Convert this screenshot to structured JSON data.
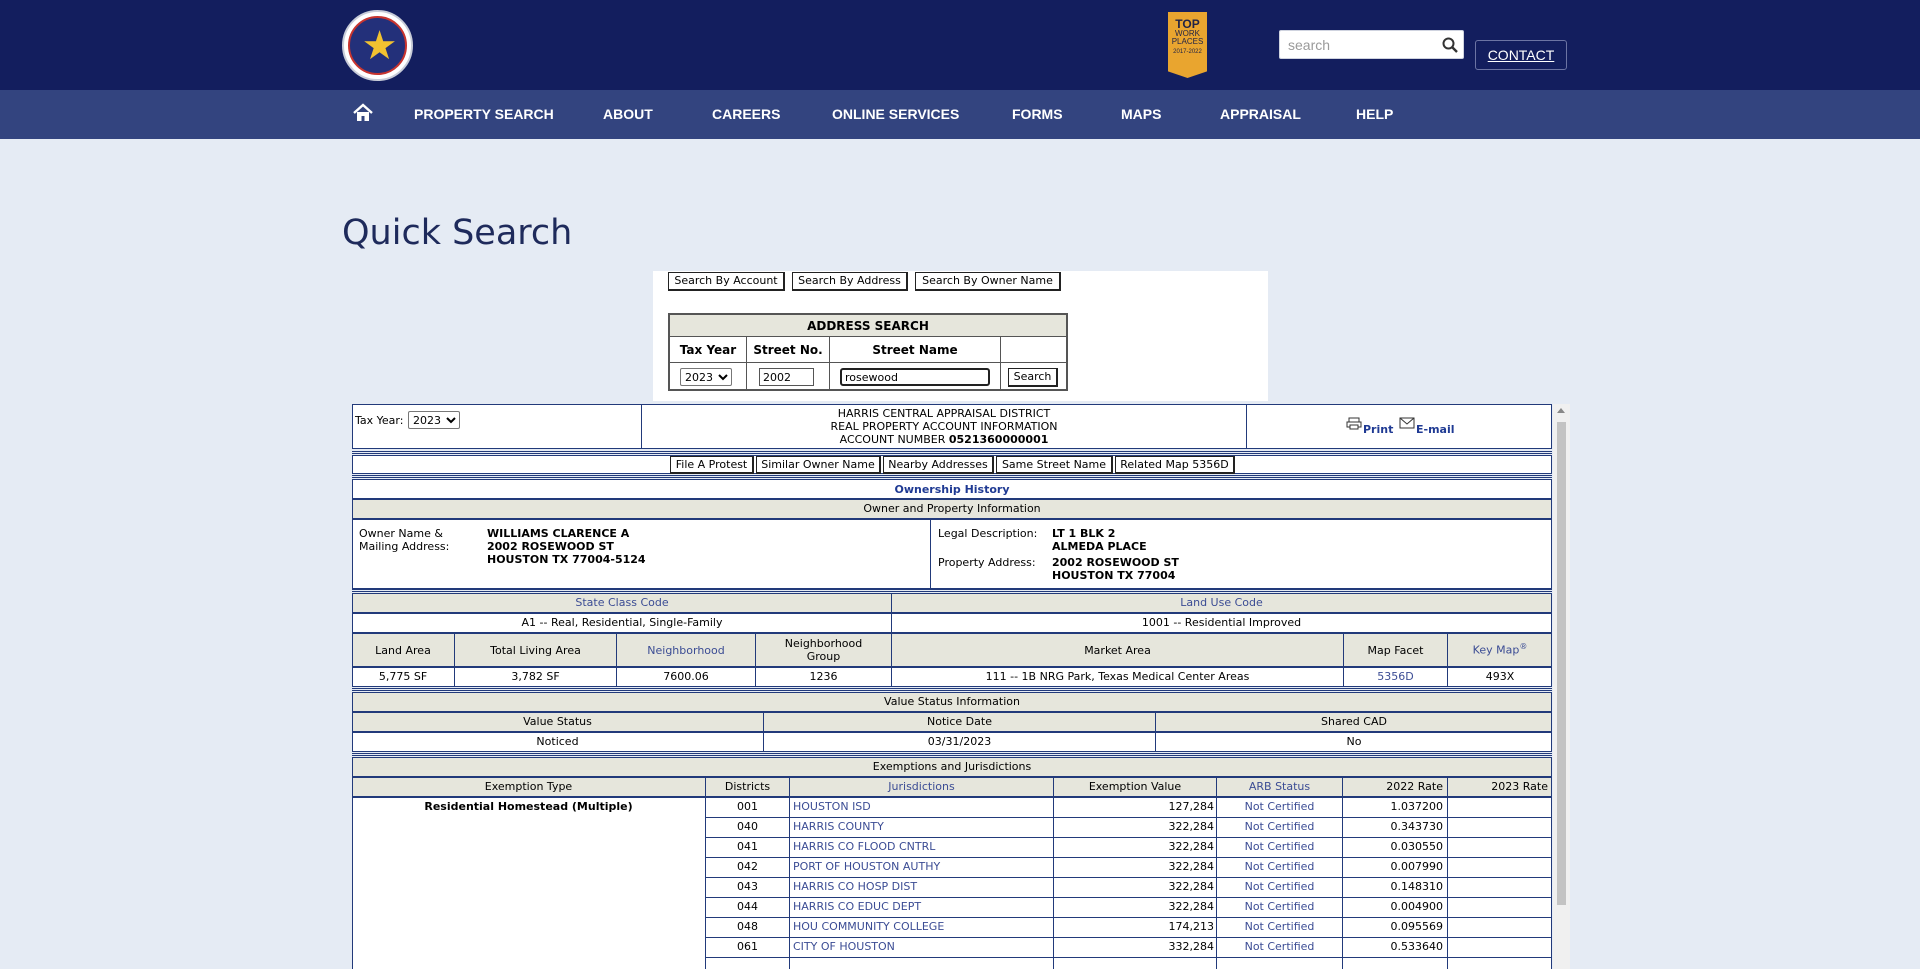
{
  "header": {
    "logo_text": "HARRIS CENTRAL APPRAISAL DISTRICT",
    "badge": {
      "line1": "TOP",
      "line2": "WORK",
      "line3": "PLACES",
      "line4": "2017-2022"
    },
    "search_placeholder": "search",
    "contact_label": "CONTACT"
  },
  "nav": {
    "items": [
      "PROPERTY SEARCH",
      "ABOUT",
      "CAREERS",
      "ONLINE SERVICES",
      "FORMS",
      "MAPS",
      "APPRAISAL",
      "HELP"
    ]
  },
  "page_title": "Quick Search",
  "search_tabs": [
    "Search By Account",
    "Search By Address",
    "Search By Owner Name"
  ],
  "address_search": {
    "title": "ADDRESS SEARCH",
    "col_tax_year": "Tax Year",
    "col_street_no": "Street No.",
    "col_street_name": "Street Name",
    "tax_year_value": "2023",
    "street_no_value": "2002",
    "street_name_value": "rosewood",
    "search_button": "Search"
  },
  "record": {
    "tax_year_label": "Tax Year:",
    "tax_year_value": "2023",
    "district": "HARRIS CENTRAL APPRAISAL DISTRICT",
    "info_title": "REAL PROPERTY ACCOUNT INFORMATION",
    "account_label": "ACCOUNT NUMBER",
    "account_number": "0521360000001",
    "print_label": "Print",
    "email_label": "E-mail",
    "action_buttons": [
      "File A Protest",
      "Similar Owner Name",
      "Nearby Addresses",
      "Same Street Name",
      "Related Map 5356D"
    ],
    "ownership_history": "Ownership History",
    "owner_section_title": "Owner and Property Information",
    "owner_label_1": "Owner Name &",
    "owner_label_2": "Mailing Address:",
    "owner_name": "WILLIAMS CLARENCE A",
    "owner_addr_1": "2002 ROSEWOOD ST",
    "owner_addr_2": "HOUSTON TX 77004-5124",
    "legal_label": "Legal Description:",
    "legal_1": "LT 1 BLK 2",
    "legal_2": "ALMEDA PLACE",
    "prop_addr_label": "Property Address:",
    "prop_addr_1": "2002 ROSEWOOD ST",
    "prop_addr_2": "HOUSTON TX 77004",
    "state_class_label": "State Class Code",
    "state_class_value": "A1 -- Real, Residential, Single-Family",
    "land_use_label": "Land Use Code",
    "land_use_value": "1001 -- Residential Improved",
    "facts_headers": {
      "land_area": "Land Area",
      "living_area": "Total Living Area",
      "neighborhood": "Neighborhood",
      "neighborhood_group_1": "Neighborhood",
      "neighborhood_group_2": "Group",
      "market_area": "Market Area",
      "map_facet": "Map Facet",
      "key_map": "Key Map",
      "key_map_sup": "®"
    },
    "facts_values": {
      "land_area": "5,775 SF",
      "living_area": "3,782 SF",
      "neighborhood": "7600.06",
      "neighborhood_group": "1236",
      "market_area": "111 -- 1B NRG Park, Texas Medical Center Areas",
      "map_facet": "5356D",
      "key_map": "493X"
    },
    "value_status_title": "Value Status Information",
    "value_status_headers": [
      "Value Status",
      "Notice Date",
      "Shared CAD"
    ],
    "value_status_values": [
      "Noticed",
      "03/31/2023",
      "No"
    ],
    "exemptions_title": "Exemptions and Jurisdictions",
    "exemption_headers": [
      "Exemption Type",
      "Districts",
      "Jurisdictions",
      "Exemption Value",
      "ARB Status",
      "2022 Rate",
      "2023 Rate"
    ],
    "exemption_type": "Residential Homestead (Multiple)",
    "jurisdictions": [
      {
        "district": "001",
        "name": "HOUSTON ISD",
        "value": "127,284",
        "arb": "Not Certified",
        "rate_2022": "1.037200",
        "rate_2023": ""
      },
      {
        "district": "040",
        "name": "HARRIS COUNTY",
        "value": "322,284",
        "arb": "Not Certified",
        "rate_2022": "0.343730",
        "rate_2023": ""
      },
      {
        "district": "041",
        "name": "HARRIS CO FLOOD CNTRL",
        "value": "322,284",
        "arb": "Not Certified",
        "rate_2022": "0.030550",
        "rate_2023": ""
      },
      {
        "district": "042",
        "name": "PORT OF HOUSTON AUTHY",
        "value": "322,284",
        "arb": "Not Certified",
        "rate_2022": "0.007990",
        "rate_2023": ""
      },
      {
        "district": "043",
        "name": "HARRIS CO HOSP DIST",
        "value": "322,284",
        "arb": "Not Certified",
        "rate_2022": "0.148310",
        "rate_2023": ""
      },
      {
        "district": "044",
        "name": "HARRIS CO EDUC DEPT",
        "value": "322,284",
        "arb": "Not Certified",
        "rate_2022": "0.004900",
        "rate_2023": ""
      },
      {
        "district": "048",
        "name": "HOU COMMUNITY COLLEGE",
        "value": "174,213",
        "arb": "Not Certified",
        "rate_2022": "0.095569",
        "rate_2023": ""
      },
      {
        "district": "061",
        "name": "CITY OF HOUSTON",
        "value": "332,284",
        "arb": "Not Certified",
        "rate_2022": "0.533640",
        "rate_2023": ""
      }
    ]
  }
}
